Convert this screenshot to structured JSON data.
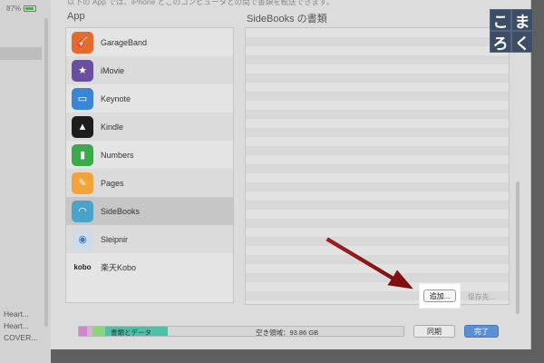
{
  "sidebar": {
    "battery_text": "87%",
    "items": [
      "Heart...",
      "Heart...",
      "COVER..."
    ]
  },
  "sheet": {
    "top_text": "以下の App では、iPhone とこのコンピュータとの間で書類を転送できます。",
    "apps_title": "App",
    "docs_title": "SideBooks の書類",
    "apps": [
      {
        "name": "GarageBand",
        "icon": "garageband-icon",
        "color": "#e46a2e"
      },
      {
        "name": "iMovie",
        "icon": "imovie-icon",
        "color": "#6a4fa0"
      },
      {
        "name": "Keynote",
        "icon": "keynote-icon",
        "color": "#3a86d4"
      },
      {
        "name": "Kindle",
        "icon": "kindle-icon",
        "color": "#1d1d1d"
      },
      {
        "name": "Numbers",
        "icon": "numbers-icon",
        "color": "#3ca94a"
      },
      {
        "name": "Pages",
        "icon": "pages-icon",
        "color": "#f2a33a"
      },
      {
        "name": "SideBooks",
        "icon": "sidebooks-icon",
        "color": "#4aa3c9"
      },
      {
        "name": "Sleipnir",
        "icon": "sleipnir-icon",
        "color": "#cfdbe6"
      },
      {
        "name": "楽天Kobo",
        "icon": "kobo-icon",
        "color": "#e4e4e4"
      }
    ],
    "add_label": "追加...",
    "save_label": "保存先..."
  },
  "footer": {
    "capacity_label": "書類とデータ",
    "free_label": "空き領域：93.86 GB",
    "sync_label": "同期",
    "done_label": "完了"
  },
  "logo": [
    "こ",
    "ま",
    "ろ",
    "く"
  ]
}
